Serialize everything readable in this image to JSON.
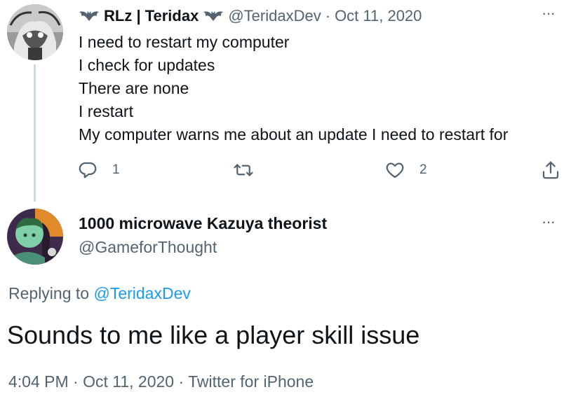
{
  "tweet1": {
    "author_name": "RLz | Teridax",
    "handle": "@TeridaxDev",
    "separator": "·",
    "date": "Oct 11, 2020",
    "more": "···",
    "lines": [
      "I need to restart my computer",
      "I check for updates",
      "There are none",
      "I restart",
      "My computer warns me about an update I need to restart for"
    ],
    "actions": {
      "reply_count": "1",
      "like_count": "2"
    },
    "badge_icon": "bat-emoji-icon"
  },
  "tweet2": {
    "author_name": "1000 microwave Kazuya theorist",
    "handle": "@GameforThought",
    "more": "···",
    "replying_prefix": "Replying to",
    "replying_to": "@TeridaxDev",
    "text": "Sounds to me like a player skill issue",
    "time": "4:04 PM",
    "separator": "·",
    "date": "Oct 11, 2020",
    "source": "Twitter for iPhone"
  },
  "colors": {
    "text": "#0f1419",
    "muted": "#536471",
    "link": "#1d9bf0",
    "thread_line": "#cfd9de"
  }
}
